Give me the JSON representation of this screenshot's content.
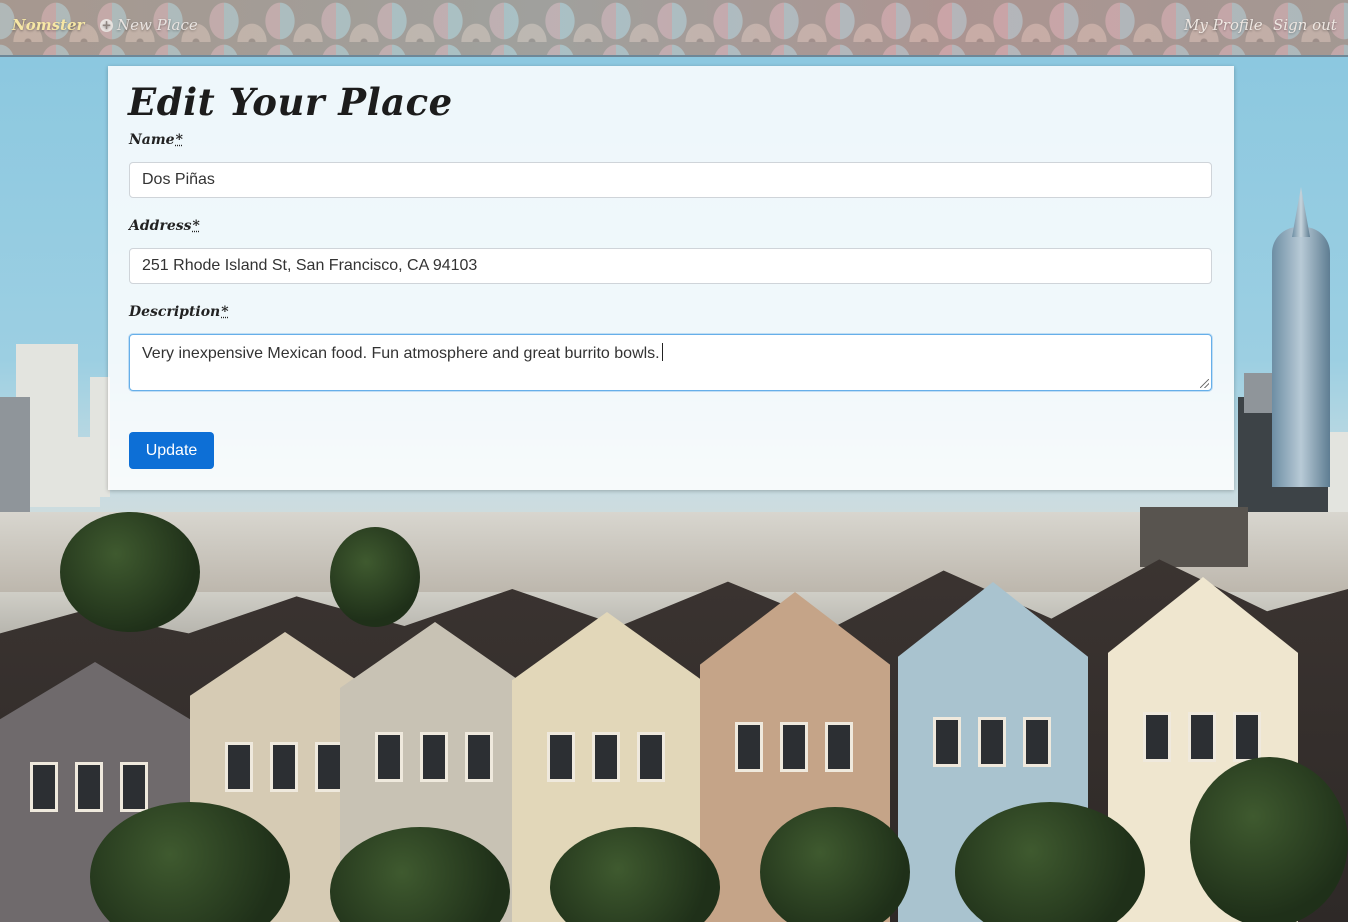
{
  "navbar": {
    "brand": "Nomster",
    "new_place": "New Place",
    "my_profile": "My Profile",
    "sign_out": "Sign out"
  },
  "form": {
    "title": "Edit Your Place",
    "required_marker": "*",
    "name": {
      "label": "Name",
      "value": "Dos Piñas"
    },
    "address": {
      "label": "Address",
      "value": "251 Rhode Island St, San Francisco, CA 94103"
    },
    "description": {
      "label": "Description",
      "value": "Very inexpensive Mexican food. Fun atmosphere and great burrito bowls."
    },
    "submit_label": "Update"
  },
  "colors": {
    "primary_button": "#0d6fd6",
    "focus_border": "#66afe9",
    "brand_text": "#f6e7a5"
  },
  "icons": {
    "new_place": "plus-circle-icon"
  }
}
